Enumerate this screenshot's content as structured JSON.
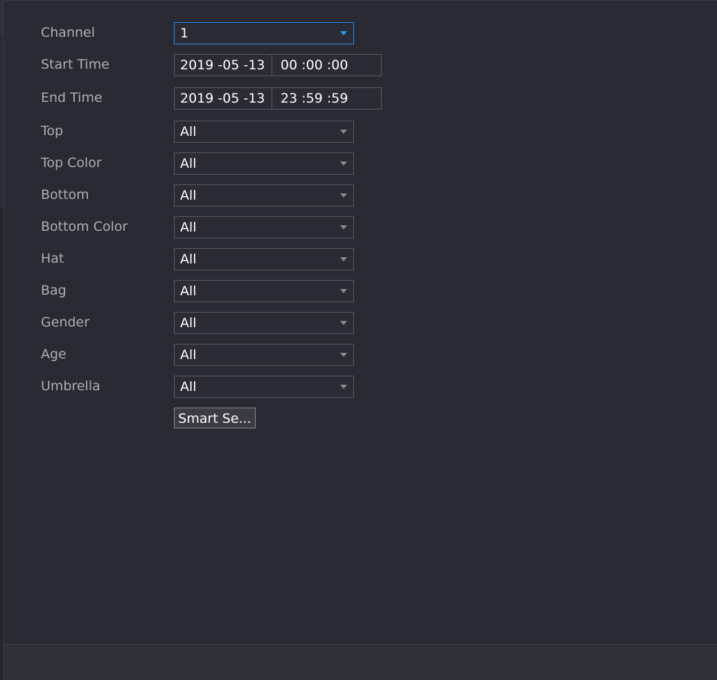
{
  "form": {
    "channel": {
      "label": "Channel",
      "value": "1"
    },
    "start_time": {
      "label": "Start Time",
      "date": "2019 -05 -13",
      "time": "00 :00 :00"
    },
    "end_time": {
      "label": "End Time",
      "date": "2019 -05 -13",
      "time": "23 :59 :59"
    },
    "filters": [
      {
        "label": "Top",
        "value": "All"
      },
      {
        "label": "Top Color",
        "value": "All"
      },
      {
        "label": "Bottom",
        "value": "All"
      },
      {
        "label": "Bottom Color",
        "value": "All"
      },
      {
        "label": "Hat",
        "value": "All"
      },
      {
        "label": "Bag",
        "value": "All"
      },
      {
        "label": "Gender",
        "value": "All"
      },
      {
        "label": "Age",
        "value": "All"
      },
      {
        "label": "Umbrella",
        "value": "All"
      }
    ],
    "smart_search_label": "Smart Se..."
  },
  "icons": {
    "dropdown": "chevron-down-icon"
  },
  "colors": {
    "background": "#292a33",
    "accent": "#2a9df4",
    "text": "#ffffff",
    "label": "#aeb0b6"
  }
}
